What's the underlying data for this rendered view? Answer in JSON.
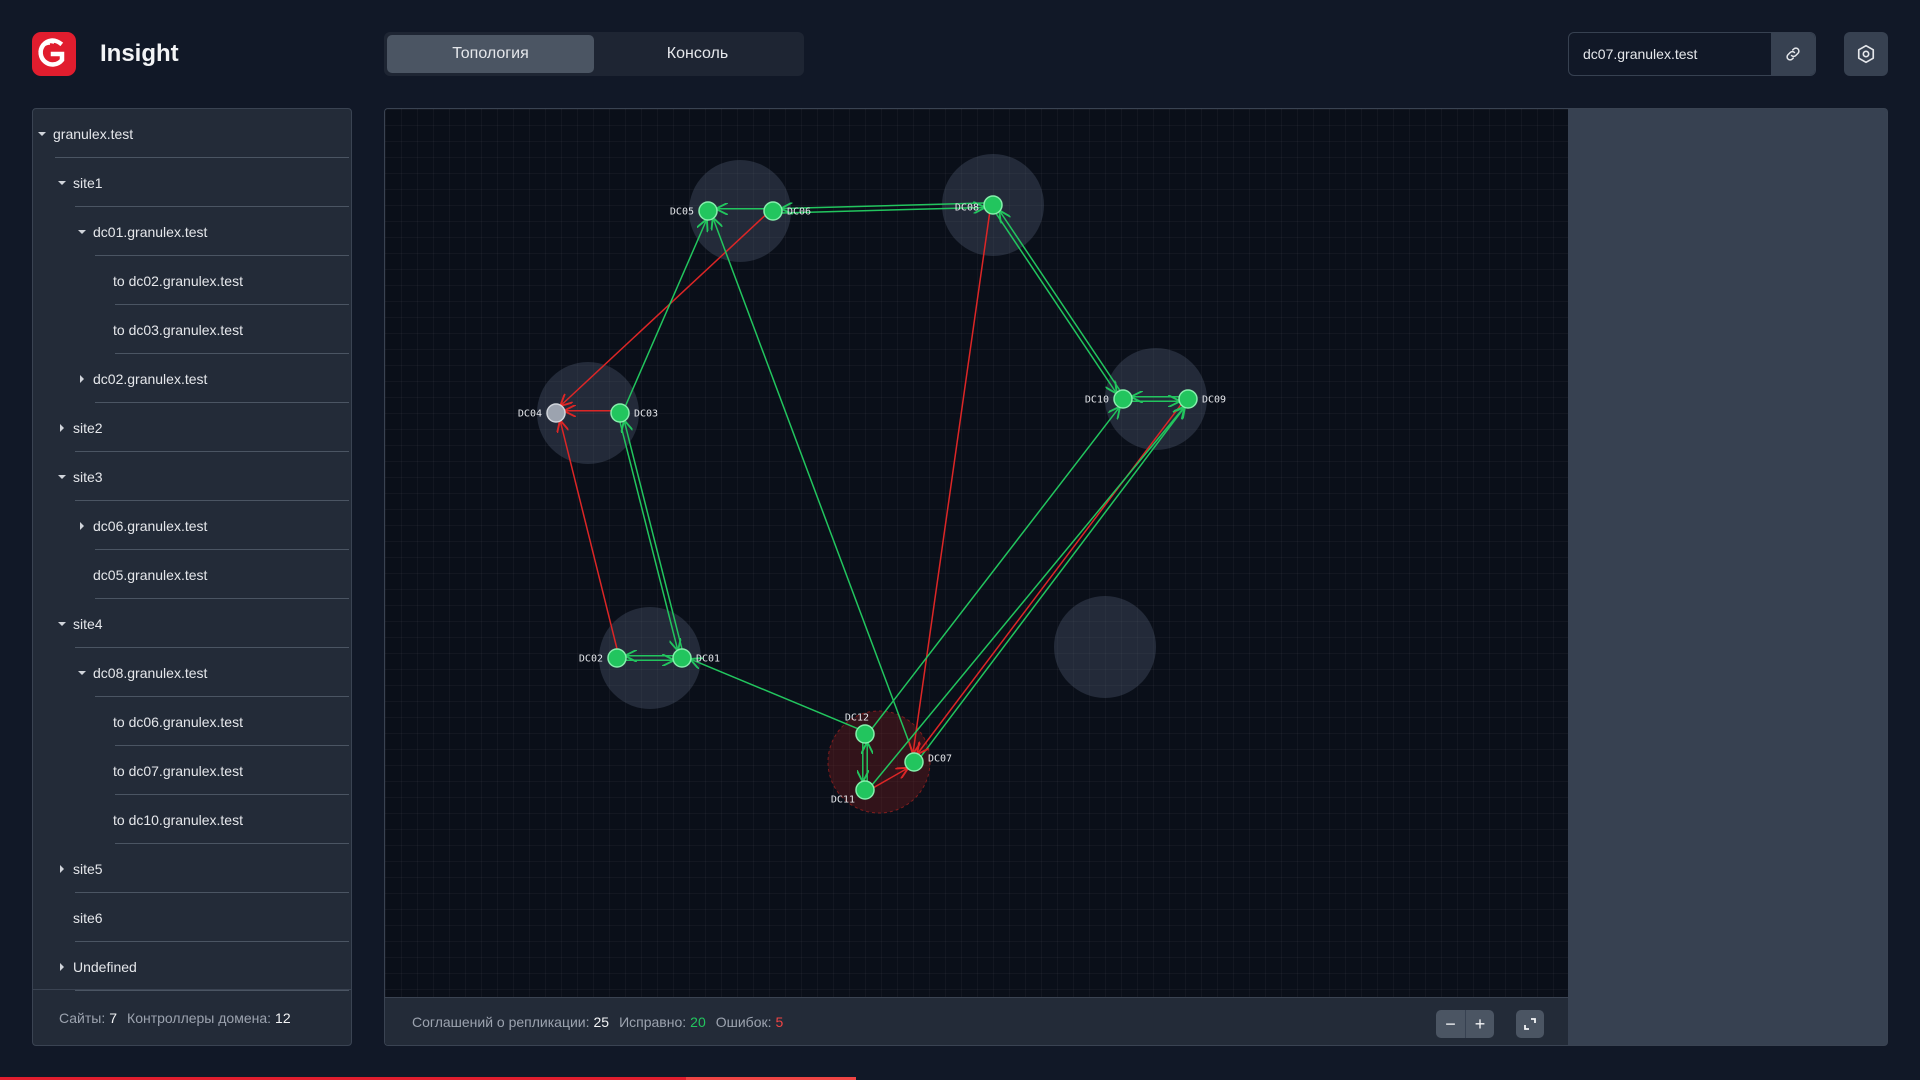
{
  "app": {
    "title": "Insight"
  },
  "tabs": [
    {
      "label": "Топология",
      "active": true
    },
    {
      "label": "Консоль",
      "active": false
    }
  ],
  "search": {
    "value": "dc07.granulex.test"
  },
  "sidebar": {
    "items": [
      {
        "label": "granulex.test",
        "level": 0,
        "caret": "down"
      },
      {
        "label": "site1",
        "level": 1,
        "caret": "down"
      },
      {
        "label": "dc01.granulex.test",
        "level": 2,
        "caret": "down"
      },
      {
        "label": "to dc02.granulex.test",
        "level": 3,
        "caret": "none"
      },
      {
        "label": "to dc03.granulex.test",
        "level": 3,
        "caret": "none"
      },
      {
        "label": "dc02.granulex.test",
        "level": 2,
        "caret": "right"
      },
      {
        "label": "site2",
        "level": 1,
        "caret": "right"
      },
      {
        "label": "site3",
        "level": 1,
        "caret": "down"
      },
      {
        "label": "dc06.granulex.test",
        "level": 2,
        "caret": "right"
      },
      {
        "label": "dc05.granulex.test",
        "level": 2,
        "caret": "none"
      },
      {
        "label": "site4",
        "level": 1,
        "caret": "down"
      },
      {
        "label": "dc08.granulex.test",
        "level": 2,
        "caret": "down"
      },
      {
        "label": "to dc06.granulex.test",
        "level": 3,
        "caret": "none"
      },
      {
        "label": "to dc07.granulex.test",
        "level": 3,
        "caret": "none"
      },
      {
        "label": "to dc10.granulex.test",
        "level": 3,
        "caret": "none"
      },
      {
        "label": "site5",
        "level": 1,
        "caret": "right"
      },
      {
        "label": "site6",
        "level": 1,
        "caret": "none"
      },
      {
        "label": "Undefined",
        "level": 1,
        "caret": "right"
      }
    ],
    "footer": {
      "sites_label": "Сайты:",
      "sites_value": "7",
      "dc_label": "Контроллеры домена:",
      "dc_value": "12"
    }
  },
  "graph": {
    "footer": {
      "agreements_label": "Соглашений о репликации:",
      "agreements_value": "25",
      "ok_label": "Исправно:",
      "ok_value": "20",
      "errors_label": "Ошибок:",
      "errors_value": "5"
    },
    "zoom_out": "−",
    "zoom_in": "+",
    "nodes": [
      {
        "id": "DC01",
        "status": "ok"
      },
      {
        "id": "DC02",
        "status": "ok"
      },
      {
        "id": "DC03",
        "status": "ok"
      },
      {
        "id": "DC04",
        "status": "offline"
      },
      {
        "id": "DC05",
        "status": "ok"
      },
      {
        "id": "DC06",
        "status": "ok"
      },
      {
        "id": "DC07",
        "status": "ok"
      },
      {
        "id": "DC08",
        "status": "ok"
      },
      {
        "id": "DC09",
        "status": "ok"
      },
      {
        "id": "DC10",
        "status": "ok"
      },
      {
        "id": "DC11",
        "status": "ok"
      },
      {
        "id": "DC12",
        "status": "ok"
      }
    ],
    "edges": [
      {
        "from": "DC06",
        "to": "DC05",
        "status": "ok"
      },
      {
        "from": "DC08",
        "to": "DC06",
        "status": "ok"
      },
      {
        "from": "DC06",
        "to": "DC08",
        "status": "ok"
      },
      {
        "from": "DC06",
        "to": "DC04",
        "status": "error"
      },
      {
        "from": "DC03",
        "to": "DC04",
        "status": "error"
      },
      {
        "from": "DC03",
        "to": "DC05",
        "status": "ok"
      },
      {
        "from": "DC07",
        "to": "DC05",
        "status": "ok"
      },
      {
        "from": "DC08",
        "to": "DC07",
        "status": "error"
      },
      {
        "from": "DC08",
        "to": "DC10",
        "status": "ok"
      },
      {
        "from": "DC10",
        "to": "DC08",
        "status": "ok"
      },
      {
        "from": "DC10",
        "to": "DC09",
        "status": "ok"
      },
      {
        "from": "DC09",
        "to": "DC10",
        "status": "ok"
      },
      {
        "from": "DC02",
        "to": "DC04",
        "status": "error"
      },
      {
        "from": "DC03",
        "to": "DC01",
        "status": "ok"
      },
      {
        "from": "DC01",
        "to": "DC03",
        "status": "ok"
      },
      {
        "from": "DC02",
        "to": "DC01",
        "status": "ok"
      },
      {
        "from": "DC01",
        "to": "DC02",
        "status": "ok"
      },
      {
        "from": "DC12",
        "to": "DC01",
        "status": "ok"
      },
      {
        "from": "DC12",
        "to": "DC10",
        "status": "ok"
      },
      {
        "from": "DC07",
        "to": "DC09",
        "status": "ok"
      },
      {
        "from": "DC09",
        "to": "DC07",
        "status": "error"
      },
      {
        "from": "DC11",
        "to": "DC09",
        "status": "ok"
      },
      {
        "from": "DC12",
        "to": "DC11",
        "status": "ok"
      },
      {
        "from": "DC11",
        "to": "DC12",
        "status": "ok"
      },
      {
        "from": "DC11",
        "to": "DC07",
        "status": "error"
      }
    ]
  },
  "colors": {
    "ok": "#22c55e",
    "error": "#dc2626",
    "offline": "#9ca3af",
    "brand": "#e11d2e"
  }
}
